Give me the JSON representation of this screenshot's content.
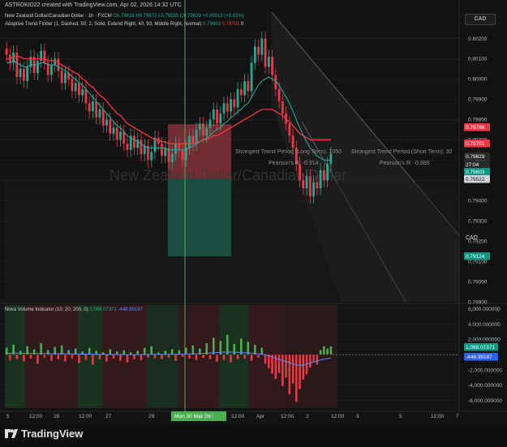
{
  "header": {
    "credit": "ASTROKID22 created with TradingView.com, Apr 02, 2026 14:32 UTC"
  },
  "legend": {
    "main_title": "New Zealand Dollar/Canadian Dollar · 1h · FXCM",
    "ohlc": "O0.79616 H0.79672 L0.79585 C0.79629 +0.00013 (+0.02%)",
    "indicator1": "Adaptive Trend Finder (1, Dashed, 50, 2, Solid, Extend Right, 40, 93, Middle Right, Normal)",
    "indicator1_v1": "0.79603",
    "indicator1_v2": "0.79701",
    "indicator1_v3": "0",
    "indicator2": "Nova Volume Indicator (10, 20, 200, 0)",
    "indicator2_v1": "1,068.07371",
    "indicator2_v2": "-448.99197"
  },
  "currency_box": "CAD",
  "currency_lower": "CAD",
  "watermark": "New Zealand Dollar/Canadian Dollar",
  "annotations": {
    "long_term": "Strongest Trend Period (Long Term): 1050",
    "short_term": "Strongest Trend Period (Short Term): 30",
    "pearson_long": "Pearson's R: -0.914",
    "pearson_short": "Pearson's R: -0.886"
  },
  "colors": {
    "up": "#22ab94",
    "down": "#f23645",
    "ema_fast": "#26a69a",
    "ema_slow": "#f23645",
    "vline": "#4caf50",
    "panel_bg": "#131313",
    "grid": "#242424"
  },
  "chart_data": [
    {
      "type": "candlestick",
      "ylim": [
        0.789,
        0.8025
      ],
      "y_ticks": [
        "0.80200",
        "0.80100",
        "0.80000",
        "0.79900",
        "0.79800",
        "0.79700",
        "0.79600",
        "0.79500",
        "0.79400",
        "0.79300",
        "0.79200",
        "0.79100",
        "0.79000",
        "0.78900"
      ],
      "price_labels": [
        {
          "value": "0.79786",
          "kind": "down"
        },
        {
          "value": "0.79701",
          "kind": "down"
        },
        {
          "value": "0.79629",
          "kind": "dark"
        },
        {
          "value": "27:04",
          "kind": "dark"
        },
        {
          "value": "0.79603",
          "kind": "up"
        },
        {
          "value": "0.79522",
          "kind": "light"
        },
        {
          "value": "0.79124",
          "kind": "up"
        }
      ],
      "x_ticks": [
        "5",
        "12:00",
        "26",
        "12:00",
        "27",
        "29",
        "Mon 30 Mar '26",
        "13:00",
        "12:00",
        "Apr",
        "12:00",
        "2",
        "12:00",
        "3",
        "5",
        "12:00",
        "7"
      ],
      "close": [
        0.8012,
        0.8008,
        0.8013,
        0.8001,
        0.8005,
        0.7999,
        0.8006,
        0.8011,
        0.8003,
        0.8009,
        0.8014,
        0.8008,
        0.8002,
        0.8007,
        0.801,
        0.8004,
        0.7998,
        0.8003,
        0.8,
        0.7994,
        0.7998,
        0.7992,
        0.7995,
        0.7988,
        0.7984,
        0.7989,
        0.7981,
        0.7985,
        0.7977,
        0.798,
        0.7973,
        0.7976,
        0.797,
        0.7974,
        0.7968,
        0.7965,
        0.7972,
        0.7966,
        0.797,
        0.7963,
        0.7967,
        0.796,
        0.7964,
        0.7971,
        0.7968,
        0.7962,
        0.7966,
        0.7959,
        0.7963,
        0.7968,
        0.7965,
        0.796,
        0.7966,
        0.7972,
        0.7968,
        0.7975,
        0.7978,
        0.7972,
        0.7976,
        0.798,
        0.7985,
        0.7978,
        0.7983,
        0.7988,
        0.7984,
        0.799,
        0.7986,
        0.7995,
        0.7992,
        0.7999,
        0.7994,
        0.8008,
        0.8016,
        0.8012,
        0.802,
        0.8006,
        0.8011,
        0.8002,
        0.7995,
        0.7989,
        0.7983,
        0.7978,
        0.7972,
        0.7966,
        0.7958,
        0.795,
        0.7946,
        0.7952,
        0.7942,
        0.7949,
        0.7946,
        0.7955,
        0.795,
        0.7958,
        0.7963
      ],
      "ema_fast": [
        0.8008,
        0.8008,
        0.8009,
        0.8008,
        0.8007,
        0.8006,
        0.8006,
        0.8007,
        0.8007,
        0.8007,
        0.8008,
        0.8008,
        0.8007,
        0.8007,
        0.8007,
        0.8006,
        0.8005,
        0.8004,
        0.8003,
        0.8001,
        0.8,
        0.7998,
        0.7997,
        0.7995,
        0.7993,
        0.7991,
        0.7989,
        0.7987,
        0.7985,
        0.7983,
        0.7981,
        0.7979,
        0.7977,
        0.7976,
        0.7974,
        0.7972,
        0.7971,
        0.797,
        0.7969,
        0.7968,
        0.7967,
        0.7966,
        0.7966,
        0.7966,
        0.7966,
        0.7966,
        0.7966,
        0.7965,
        0.7965,
        0.7965,
        0.7965,
        0.7965,
        0.7965,
        0.7966,
        0.7967,
        0.7968,
        0.7969,
        0.797,
        0.7971,
        0.7972,
        0.7974,
        0.7975,
        0.7976,
        0.7978,
        0.7979,
        0.7981,
        0.7982,
        0.7984,
        0.7985,
        0.7987,
        0.7988,
        0.7991,
        0.7994,
        0.7997,
        0.7999,
        0.8,
        0.8001,
        0.8,
        0.7999,
        0.7997,
        0.7994,
        0.7991,
        0.7988,
        0.7984,
        0.798,
        0.7976,
        0.7972,
        0.7969,
        0.7966,
        0.7964,
        0.7962,
        0.7961,
        0.796,
        0.796,
        0.796
      ],
      "ema_slow": [
        0.801,
        0.801,
        0.8011,
        0.8011,
        0.8011,
        0.801,
        0.801,
        0.801,
        0.801,
        0.801,
        0.801,
        0.801,
        0.8009,
        0.8009,
        0.8009,
        0.8008,
        0.8007,
        0.8006,
        0.8005,
        0.8004,
        0.8003,
        0.8002,
        0.8,
        0.7999,
        0.7997,
        0.7996,
        0.7994,
        0.7992,
        0.7991,
        0.7989,
        0.7987,
        0.7985,
        0.7983,
        0.7982,
        0.798,
        0.7978,
        0.7977,
        0.7976,
        0.7975,
        0.7974,
        0.7973,
        0.7972,
        0.7971,
        0.797,
        0.797,
        0.7969,
        0.7969,
        0.7968,
        0.7968,
        0.7968,
        0.7968,
        0.7968,
        0.7968,
        0.7968,
        0.7968,
        0.7969,
        0.7969,
        0.797,
        0.797,
        0.7971,
        0.7972,
        0.7972,
        0.7973,
        0.7974,
        0.7975,
        0.7976,
        0.7977,
        0.7978,
        0.7979,
        0.798,
        0.7981,
        0.7982,
        0.7983,
        0.7984,
        0.7985,
        0.7985,
        0.7985,
        0.7985,
        0.7984,
        0.7983,
        0.7982,
        0.798,
        0.7979,
        0.7977,
        0.7975,
        0.7973,
        0.7972,
        0.7971,
        0.797,
        0.797,
        0.797,
        0.797,
        0.797,
        0.797,
        0.797
      ]
    },
    {
      "type": "bar",
      "ylim": [
        -7000,
        6500
      ],
      "y_ticks": [
        "6,000.000000",
        "4,000.000000",
        "2,000.000000",
        "0.000000",
        "-2,000.000000",
        "-4,000.000000",
        "-6,000.000000"
      ],
      "price_labels": [
        {
          "value": "1,068.07371",
          "kind": "up"
        },
        {
          "value": "-448.99197",
          "kind": "blue"
        }
      ],
      "values": [
        900,
        -700,
        1300,
        -600,
        500,
        -900,
        1100,
        -500,
        700,
        -1200,
        1500,
        -400,
        600,
        -800,
        1000,
        -600,
        1200,
        -900,
        600,
        -500,
        800,
        -1100,
        400,
        -700,
        900,
        -1300,
        500,
        -600,
        300,
        -900,
        700,
        -500,
        400,
        -800,
        600,
        -1000,
        300,
        -600,
        500,
        -700,
        900,
        -400,
        1100,
        -500,
        300,
        -600,
        500,
        -400,
        700,
        -800,
        600,
        -300,
        900,
        -500,
        1200,
        -700,
        800,
        -400,
        1500,
        -600,
        2200,
        -900,
        1800,
        -700,
        2600,
        -1000,
        1400,
        -600,
        2100,
        -500,
        1700,
        -800,
        1300,
        -400,
        900,
        -1200,
        -1800,
        -2500,
        -3200,
        -2400,
        -4100,
        -3000,
        -5200,
        -3800,
        -6200,
        -4500,
        -3300,
        -2600,
        -1700,
        -900,
        -1300,
        600,
        1100,
        800,
        1068
      ],
      "signal": [
        200,
        180,
        220,
        200,
        190,
        170,
        180,
        170,
        160,
        140,
        160,
        150,
        140,
        120,
        130,
        120,
        130,
        110,
        100,
        90,
        90,
        80,
        70,
        60,
        70,
        50,
        40,
        40,
        30,
        20,
        30,
        20,
        20,
        10,
        20,
        10,
        0,
        -10,
        0,
        10,
        20,
        30,
        40,
        30,
        30,
        20,
        30,
        40,
        50,
        40,
        50,
        60,
        80,
        90,
        100,
        120,
        140,
        160,
        190,
        220,
        260,
        280,
        300,
        320,
        340,
        330,
        320,
        300,
        280,
        260,
        230,
        200,
        160,
        110,
        60,
        -20,
        -150,
        -300,
        -480,
        -620,
        -780,
        -900,
        -1050,
        -1200,
        -1350,
        -1420,
        -1380,
        -1250,
        -1100,
        -950,
        -830,
        -700,
        -600,
        -520,
        -449
      ]
    }
  ]
}
